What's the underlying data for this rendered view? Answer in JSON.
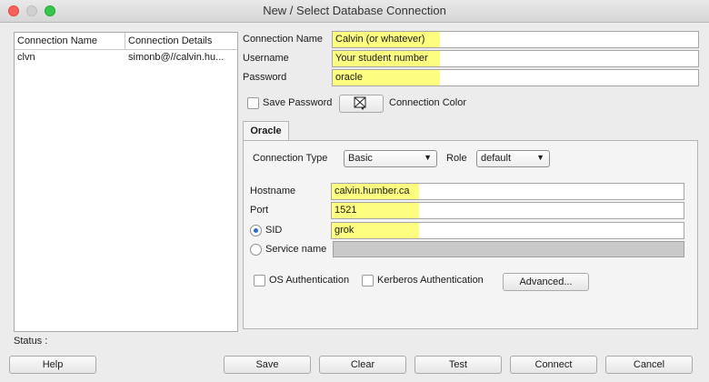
{
  "window": {
    "title": "New / Select Database Connection"
  },
  "connection_list": {
    "columns": [
      "Connection Name",
      "Connection Details"
    ],
    "rows": [
      {
        "name": "clvn",
        "details": "simonb@//calvin.hu..."
      }
    ]
  },
  "form": {
    "connection_name_label": "Connection Name",
    "connection_name_value": "Calvin (or whatever)",
    "username_label": "Username",
    "username_value": "Your student number",
    "password_label": "Password",
    "password_value": "oracle",
    "save_password_label": "Save Password",
    "save_password_checked": false,
    "connection_color_label": "Connection Color"
  },
  "tabs": [
    {
      "label": "Oracle",
      "active": true
    }
  ],
  "oracle": {
    "connection_type_label": "Connection Type",
    "connection_type_value": "Basic",
    "role_label": "Role",
    "role_value": "default",
    "hostname_label": "Hostname",
    "hostname_value": "calvin.humber.ca",
    "port_label": "Port",
    "port_value": "1521",
    "sid_label": "SID",
    "sid_value": "grok",
    "sid_selected": true,
    "service_name_label": "Service name",
    "service_name_value": "",
    "os_auth_label": "OS Authentication",
    "kerberos_auth_label": "Kerberos Authentication",
    "advanced_label": "Advanced..."
  },
  "status": {
    "label": "Status :",
    "value": ""
  },
  "buttons": {
    "help": "Help",
    "save": "Save",
    "clear": "Clear",
    "test": "Test",
    "connect": "Connect",
    "cancel": "Cancel"
  },
  "colors": {
    "highlight": "#fdfd7f",
    "radio_selected": "#2c6fd3",
    "close": "#fc605c",
    "maximize": "#34c84a"
  },
  "icons": {
    "close": "close-icon",
    "minimize": "minimize-icon",
    "maximize": "maximize-icon",
    "connection_color": "color-swatch-icon",
    "dropdown": "chevron-down-icon"
  }
}
